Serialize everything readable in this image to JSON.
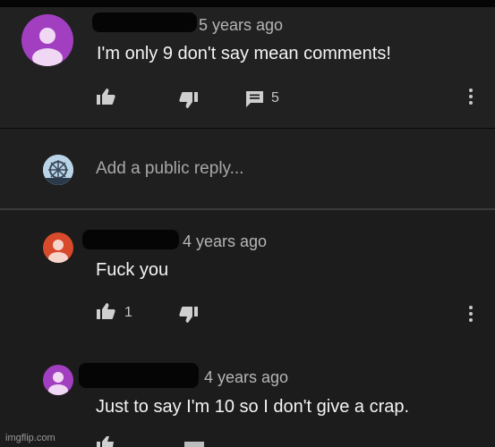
{
  "comment": {
    "time": "5 years ago",
    "text": "I'm only 9 don't say mean comments!",
    "reply_count": "5",
    "avatar_color": "#a23fc0"
  },
  "reply_box": {
    "placeholder": "Add a public reply..."
  },
  "replies": [
    {
      "time": "4 years ago",
      "text": "Fuck you",
      "like_count": "1",
      "avatar_color": "#d84a2c"
    },
    {
      "time": "4 years ago",
      "text": "Just to say I'm 10 so I don't give a crap.",
      "avatar_color": "#a23fc0"
    }
  ],
  "watermark": "imgflip.com"
}
